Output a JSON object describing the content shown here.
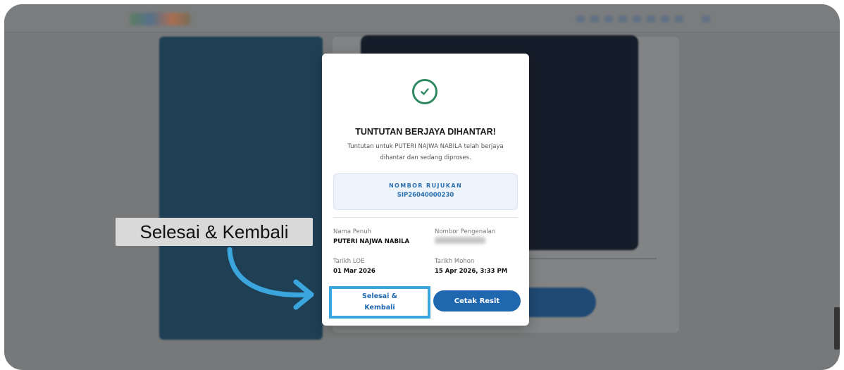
{
  "modal": {
    "title": "TUNTUTAN BERJAYA DIHANTAR!",
    "description": "Tuntutan untuk PUTERI NAJWA NABILA telah berjaya dihantar dan sedang diproses.",
    "reference": {
      "label": "NOMBOR RUJUKAN",
      "value": "SIP26040000230"
    },
    "fields": {
      "nama_penuh_label": "Nama Penuh",
      "nama_penuh_value": "PUTERI NAJWA NABILA",
      "nombor_pengenalan_label": "Nombor Pengenalan",
      "tarikh_loe_label": "Tarikh LOE",
      "tarikh_loe_value": "01 Mar 2026",
      "tarikh_mohon_label": "Tarikh Mohon",
      "tarikh_mohon_value": "15 Apr 2026, 3:33 PM"
    },
    "buttons": {
      "selesai_label": "Selesai & Kembali",
      "cetak_label": "Cetak Resit"
    }
  },
  "annotation": {
    "callout_text": "Selesai & Kembali"
  },
  "colors": {
    "success": "#2f8a63",
    "primary": "#1f68b0",
    "highlight": "#3aa6dd",
    "reference_bg": "#eef4fb"
  },
  "icons": {
    "success": "check-circle-icon",
    "arrow": "curved-arrow-icon"
  }
}
